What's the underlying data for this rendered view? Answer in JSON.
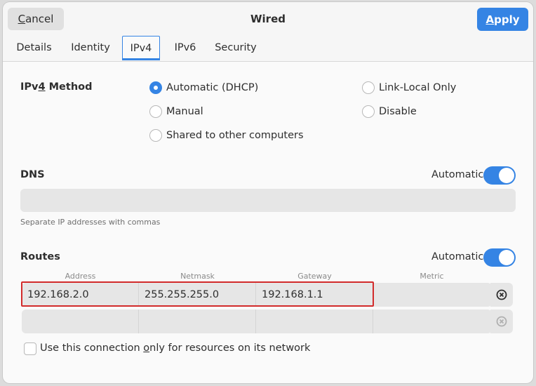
{
  "header": {
    "title": "Wired",
    "cancel_label": "Cancel",
    "apply_label": "Apply"
  },
  "tabs": [
    {
      "label": "Details"
    },
    {
      "label": "Identity"
    },
    {
      "label": "IPv4",
      "selected": true
    },
    {
      "label": "IPv6"
    },
    {
      "label": "Security"
    }
  ],
  "ipv4_method": {
    "label": "IPv4 Method",
    "options": [
      {
        "label": "Automatic (DHCP)",
        "checked": true
      },
      {
        "label": "Link-Local Only",
        "checked": false
      },
      {
        "label": "Manual",
        "checked": false
      },
      {
        "label": "Disable",
        "checked": false
      },
      {
        "label": "Shared to other computers",
        "checked": false
      }
    ]
  },
  "dns": {
    "label": "DNS",
    "automatic_label": "Automatic",
    "automatic_on": true,
    "value": "",
    "hint": "Separate IP addresses with commas"
  },
  "routes": {
    "label": "Routes",
    "automatic_label": "Automatic",
    "automatic_on": true,
    "columns": [
      "Address",
      "Netmask",
      "Gateway",
      "Metric"
    ],
    "rows": [
      {
        "address": "192.168.2.0",
        "netmask": "255.255.255.0",
        "gateway": "192.168.1.1",
        "metric": ""
      },
      {
        "address": "",
        "netmask": "",
        "gateway": "",
        "metric": ""
      }
    ]
  },
  "only_local": {
    "label": "Use this connection only for resources on its network",
    "checked": false
  },
  "colors": {
    "accent": "#3584e4",
    "highlight": "#d22b2b"
  }
}
